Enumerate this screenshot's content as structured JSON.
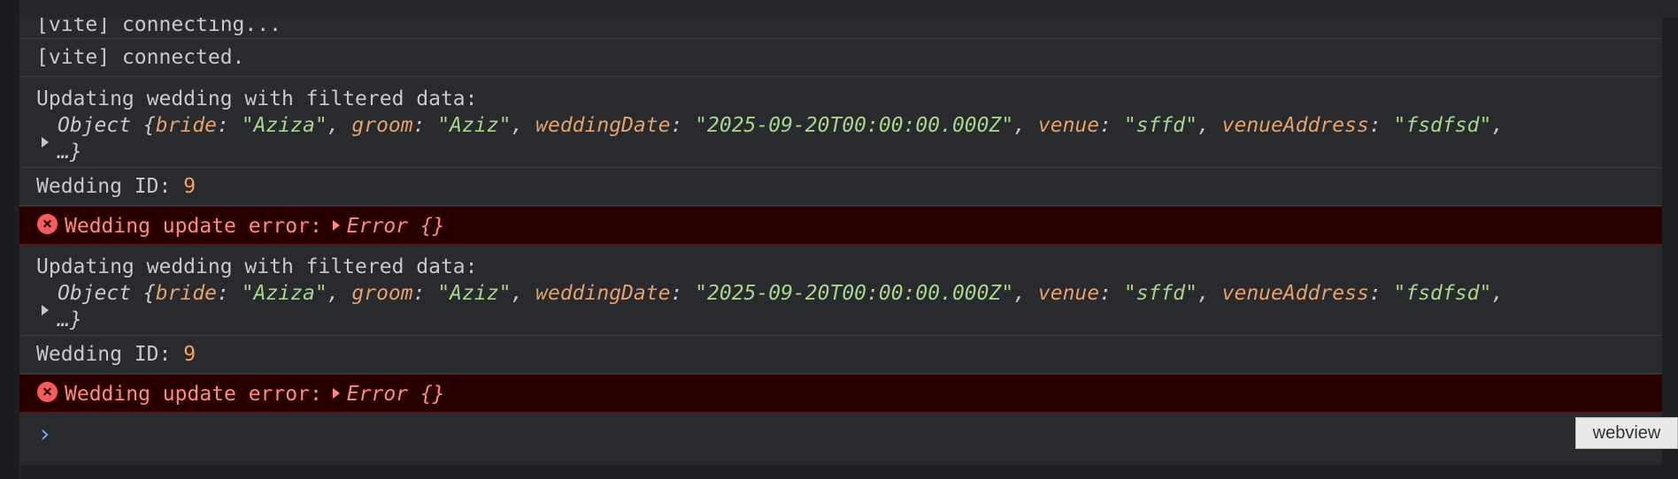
{
  "console": {
    "rows": [
      {
        "type": "log",
        "text": "[vite] connecting..."
      },
      {
        "type": "log",
        "text": "[vite] connected."
      },
      {
        "type": "object",
        "label": "Updating wedding with filtered data:",
        "object_prefix": "Object {",
        "fields": [
          {
            "key": "bride",
            "value": "\"Aziza\""
          },
          {
            "key": "groom",
            "value": "\"Aziz\""
          },
          {
            "key": "weddingDate",
            "value": "\"2025-09-20T00:00:00.000Z\""
          },
          {
            "key": "venue",
            "value": "\"sffd\""
          },
          {
            "key": "venueAddress",
            "value": "\"fsdfsd\""
          }
        ],
        "overflow": "…}"
      },
      {
        "type": "id",
        "label": "Wedding ID:",
        "value": "9"
      },
      {
        "type": "error",
        "text": "Wedding update error:",
        "value": "Error {}"
      },
      {
        "type": "object",
        "label": "Updating wedding with filtered data:",
        "object_prefix": "Object {",
        "fields": [
          {
            "key": "bride",
            "value": "\"Aziza\""
          },
          {
            "key": "groom",
            "value": "\"Aziz\""
          },
          {
            "key": "weddingDate",
            "value": "\"2025-09-20T00:00:00.000Z\""
          },
          {
            "key": "venue",
            "value": "\"sffd\""
          },
          {
            "key": "venueAddress",
            "value": "\"fsdfsd\""
          }
        ],
        "overflow": "…}"
      },
      {
        "type": "id",
        "label": "Wedding ID:",
        "value": "9"
      },
      {
        "type": "error",
        "text": "Wedding update error:",
        "value": "Error {}"
      }
    ],
    "prompt_glyph": "›"
  },
  "tooltip": "webview",
  "colors": {
    "key": "#e3a16b",
    "string": "#a9d48c",
    "number": "#f0a35c",
    "error_text": "#ff8a80",
    "error_bg": "#290000",
    "prompt": "#6aa6ff"
  },
  "icons": {
    "error": "error-circle-icon",
    "expand": "disclosure-triangle-icon",
    "prompt": "chevron-right-icon"
  }
}
